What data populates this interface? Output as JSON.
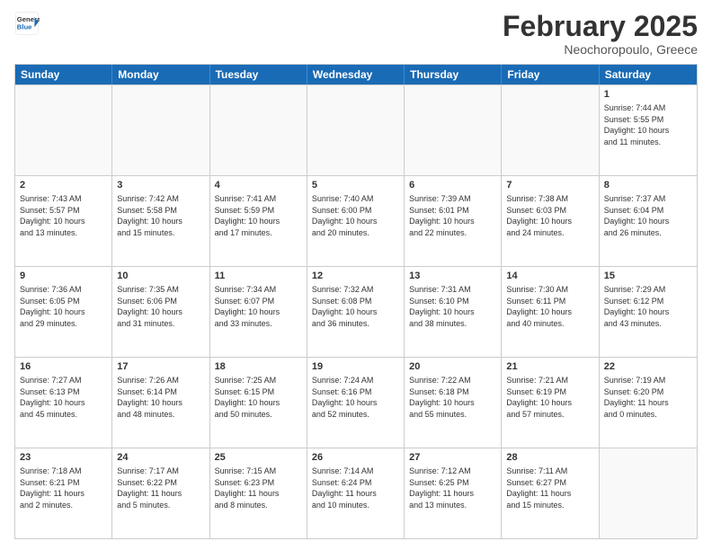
{
  "header": {
    "logo_general": "General",
    "logo_blue": "Blue",
    "month": "February 2025",
    "location": "Neochoropoulo, Greece"
  },
  "days_of_week": [
    "Sunday",
    "Monday",
    "Tuesday",
    "Wednesday",
    "Thursday",
    "Friday",
    "Saturday"
  ],
  "weeks": [
    [
      {
        "day": "",
        "info": ""
      },
      {
        "day": "",
        "info": ""
      },
      {
        "day": "",
        "info": ""
      },
      {
        "day": "",
        "info": ""
      },
      {
        "day": "",
        "info": ""
      },
      {
        "day": "",
        "info": ""
      },
      {
        "day": "1",
        "info": "Sunrise: 7:44 AM\nSunset: 5:55 PM\nDaylight: 10 hours\nand 11 minutes."
      }
    ],
    [
      {
        "day": "2",
        "info": "Sunrise: 7:43 AM\nSunset: 5:57 PM\nDaylight: 10 hours\nand 13 minutes."
      },
      {
        "day": "3",
        "info": "Sunrise: 7:42 AM\nSunset: 5:58 PM\nDaylight: 10 hours\nand 15 minutes."
      },
      {
        "day": "4",
        "info": "Sunrise: 7:41 AM\nSunset: 5:59 PM\nDaylight: 10 hours\nand 17 minutes."
      },
      {
        "day": "5",
        "info": "Sunrise: 7:40 AM\nSunset: 6:00 PM\nDaylight: 10 hours\nand 20 minutes."
      },
      {
        "day": "6",
        "info": "Sunrise: 7:39 AM\nSunset: 6:01 PM\nDaylight: 10 hours\nand 22 minutes."
      },
      {
        "day": "7",
        "info": "Sunrise: 7:38 AM\nSunset: 6:03 PM\nDaylight: 10 hours\nand 24 minutes."
      },
      {
        "day": "8",
        "info": "Sunrise: 7:37 AM\nSunset: 6:04 PM\nDaylight: 10 hours\nand 26 minutes."
      }
    ],
    [
      {
        "day": "9",
        "info": "Sunrise: 7:36 AM\nSunset: 6:05 PM\nDaylight: 10 hours\nand 29 minutes."
      },
      {
        "day": "10",
        "info": "Sunrise: 7:35 AM\nSunset: 6:06 PM\nDaylight: 10 hours\nand 31 minutes."
      },
      {
        "day": "11",
        "info": "Sunrise: 7:34 AM\nSunset: 6:07 PM\nDaylight: 10 hours\nand 33 minutes."
      },
      {
        "day": "12",
        "info": "Sunrise: 7:32 AM\nSunset: 6:08 PM\nDaylight: 10 hours\nand 36 minutes."
      },
      {
        "day": "13",
        "info": "Sunrise: 7:31 AM\nSunset: 6:10 PM\nDaylight: 10 hours\nand 38 minutes."
      },
      {
        "day": "14",
        "info": "Sunrise: 7:30 AM\nSunset: 6:11 PM\nDaylight: 10 hours\nand 40 minutes."
      },
      {
        "day": "15",
        "info": "Sunrise: 7:29 AM\nSunset: 6:12 PM\nDaylight: 10 hours\nand 43 minutes."
      }
    ],
    [
      {
        "day": "16",
        "info": "Sunrise: 7:27 AM\nSunset: 6:13 PM\nDaylight: 10 hours\nand 45 minutes."
      },
      {
        "day": "17",
        "info": "Sunrise: 7:26 AM\nSunset: 6:14 PM\nDaylight: 10 hours\nand 48 minutes."
      },
      {
        "day": "18",
        "info": "Sunrise: 7:25 AM\nSunset: 6:15 PM\nDaylight: 10 hours\nand 50 minutes."
      },
      {
        "day": "19",
        "info": "Sunrise: 7:24 AM\nSunset: 6:16 PM\nDaylight: 10 hours\nand 52 minutes."
      },
      {
        "day": "20",
        "info": "Sunrise: 7:22 AM\nSunset: 6:18 PM\nDaylight: 10 hours\nand 55 minutes."
      },
      {
        "day": "21",
        "info": "Sunrise: 7:21 AM\nSunset: 6:19 PM\nDaylight: 10 hours\nand 57 minutes."
      },
      {
        "day": "22",
        "info": "Sunrise: 7:19 AM\nSunset: 6:20 PM\nDaylight: 11 hours\nand 0 minutes."
      }
    ],
    [
      {
        "day": "23",
        "info": "Sunrise: 7:18 AM\nSunset: 6:21 PM\nDaylight: 11 hours\nand 2 minutes."
      },
      {
        "day": "24",
        "info": "Sunrise: 7:17 AM\nSunset: 6:22 PM\nDaylight: 11 hours\nand 5 minutes."
      },
      {
        "day": "25",
        "info": "Sunrise: 7:15 AM\nSunset: 6:23 PM\nDaylight: 11 hours\nand 8 minutes."
      },
      {
        "day": "26",
        "info": "Sunrise: 7:14 AM\nSunset: 6:24 PM\nDaylight: 11 hours\nand 10 minutes."
      },
      {
        "day": "27",
        "info": "Sunrise: 7:12 AM\nSunset: 6:25 PM\nDaylight: 11 hours\nand 13 minutes."
      },
      {
        "day": "28",
        "info": "Sunrise: 7:11 AM\nSunset: 6:27 PM\nDaylight: 11 hours\nand 15 minutes."
      },
      {
        "day": "",
        "info": ""
      }
    ]
  ]
}
